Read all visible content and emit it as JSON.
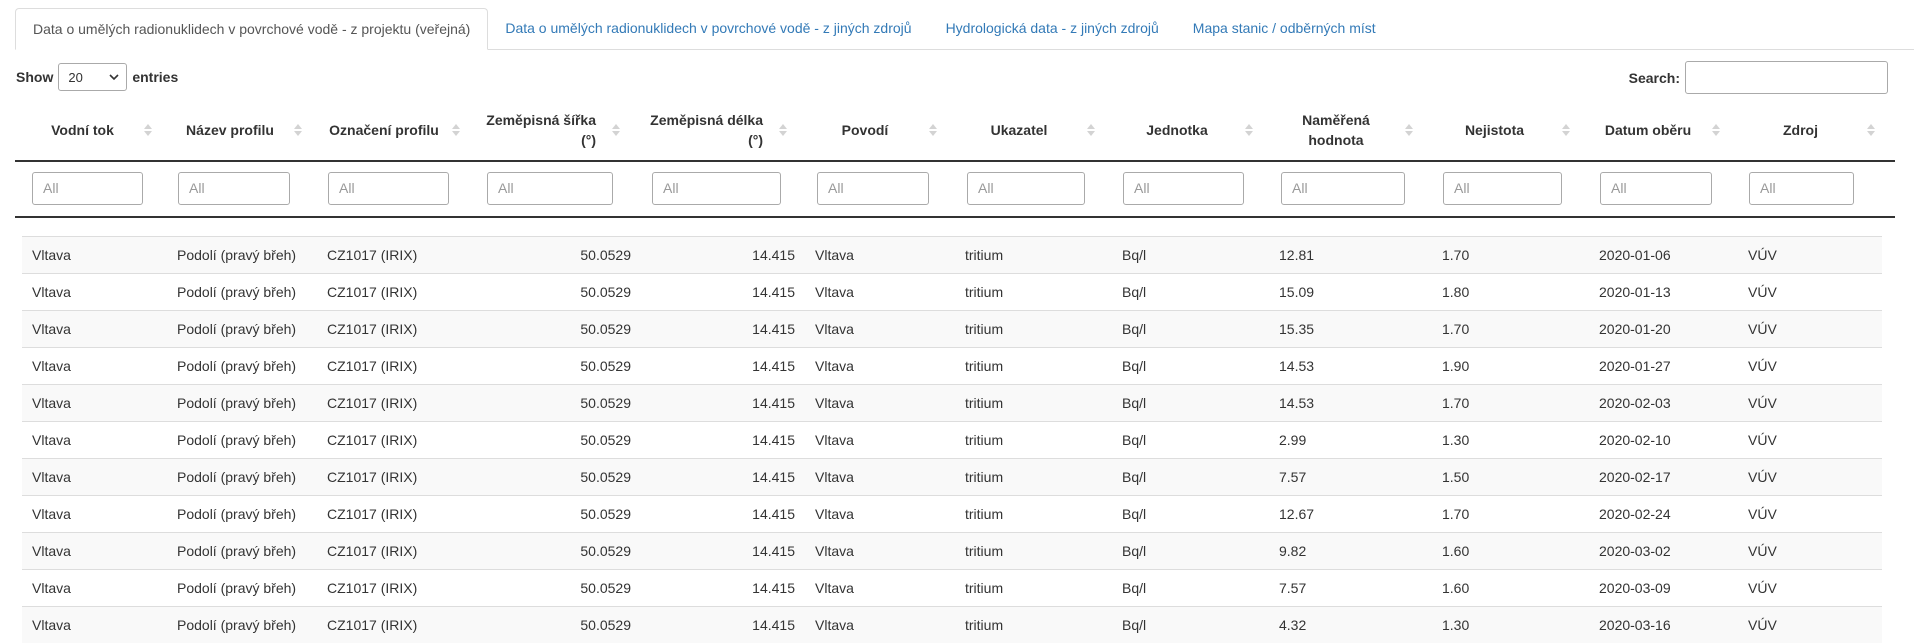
{
  "tabs": [
    {
      "label": "Data o umělých radionuklidech v povrchové vodě - z projektu (veřejná)"
    },
    {
      "label": "Data o umělých radionuklidech v povrchové vodě - z jiných zdrojů"
    },
    {
      "label": "Hydrologická data - z jiných zdrojů"
    },
    {
      "label": "Mapa stanic / odběrných míst"
    }
  ],
  "length_control": {
    "show_label": "Show",
    "value": "20",
    "entries_label": "entries"
  },
  "search": {
    "label": "Search:",
    "value": ""
  },
  "columns": [
    {
      "line1": "Vodní tok",
      "line2": ""
    },
    {
      "line1": "Název profilu",
      "line2": ""
    },
    {
      "line1": "Označení profilu",
      "line2": ""
    },
    {
      "line1": "Zeměpisná šířka",
      "line2": "(°)"
    },
    {
      "line1": "Zeměpisná délka",
      "line2": "(°)"
    },
    {
      "line1": "Povodí",
      "line2": ""
    },
    {
      "line1": "Ukazatel",
      "line2": ""
    },
    {
      "line1": "Jednotka",
      "line2": ""
    },
    {
      "line1": "Naměřená",
      "line2": "hodnota"
    },
    {
      "line1": "Nejistota",
      "line2": ""
    },
    {
      "line1": "Datum oběru",
      "line2": ""
    },
    {
      "line1": "Zdroj",
      "line2": ""
    }
  ],
  "filter_placeholder": "All",
  "rows": [
    [
      "Vltava",
      "Podolí (pravý břeh)",
      "CZ1017 (IRIX)",
      "50.0529",
      "14.415",
      "Vltava",
      "tritium",
      "Bq/l",
      "12.81",
      "1.70",
      "2020-01-06",
      "VÚV"
    ],
    [
      "Vltava",
      "Podolí (pravý břeh)",
      "CZ1017 (IRIX)",
      "50.0529",
      "14.415",
      "Vltava",
      "tritium",
      "Bq/l",
      "15.09",
      "1.80",
      "2020-01-13",
      "VÚV"
    ],
    [
      "Vltava",
      "Podolí (pravý břeh)",
      "CZ1017 (IRIX)",
      "50.0529",
      "14.415",
      "Vltava",
      "tritium",
      "Bq/l",
      "15.35",
      "1.70",
      "2020-01-20",
      "VÚV"
    ],
    [
      "Vltava",
      "Podolí (pravý břeh)",
      "CZ1017 (IRIX)",
      "50.0529",
      "14.415",
      "Vltava",
      "tritium",
      "Bq/l",
      "14.53",
      "1.90",
      "2020-01-27",
      "VÚV"
    ],
    [
      "Vltava",
      "Podolí (pravý břeh)",
      "CZ1017 (IRIX)",
      "50.0529",
      "14.415",
      "Vltava",
      "tritium",
      "Bq/l",
      "14.53",
      "1.70",
      "2020-02-03",
      "VÚV"
    ],
    [
      "Vltava",
      "Podolí (pravý břeh)",
      "CZ1017 (IRIX)",
      "50.0529",
      "14.415",
      "Vltava",
      "tritium",
      "Bq/l",
      "2.99",
      "1.30",
      "2020-02-10",
      "VÚV"
    ],
    [
      "Vltava",
      "Podolí (pravý břeh)",
      "CZ1017 (IRIX)",
      "50.0529",
      "14.415",
      "Vltava",
      "tritium",
      "Bq/l",
      "7.57",
      "1.50",
      "2020-02-17",
      "VÚV"
    ],
    [
      "Vltava",
      "Podolí (pravý břeh)",
      "CZ1017 (IRIX)",
      "50.0529",
      "14.415",
      "Vltava",
      "tritium",
      "Bq/l",
      "12.67",
      "1.70",
      "2020-02-24",
      "VÚV"
    ],
    [
      "Vltava",
      "Podolí (pravý břeh)",
      "CZ1017 (IRIX)",
      "50.0529",
      "14.415",
      "Vltava",
      "tritium",
      "Bq/l",
      "9.82",
      "1.60",
      "2020-03-02",
      "VÚV"
    ],
    [
      "Vltava",
      "Podolí (pravý břeh)",
      "CZ1017 (IRIX)",
      "50.0529",
      "14.415",
      "Vltava",
      "tritium",
      "Bq/l",
      "7.57",
      "1.60",
      "2020-03-09",
      "VÚV"
    ],
    [
      "Vltava",
      "Podolí (pravý břeh)",
      "CZ1017 (IRIX)",
      "50.0529",
      "14.415",
      "Vltava",
      "tritium",
      "Bq/l",
      "4.32",
      "1.30",
      "2020-03-16",
      "VÚV"
    ]
  ]
}
